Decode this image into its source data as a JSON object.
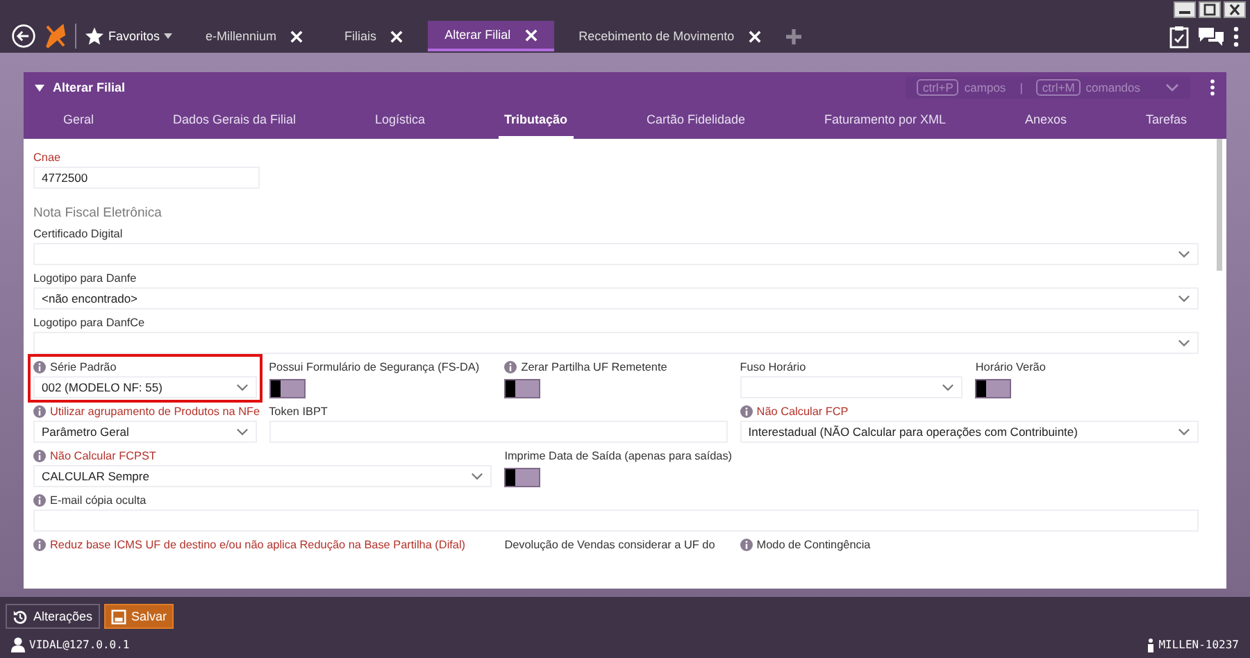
{
  "top_bar": {
    "favorites": "Favoritos",
    "tabs": [
      {
        "label": "e-Millennium",
        "selected": false
      },
      {
        "label": "Filiais",
        "selected": false
      },
      {
        "label": "Alterar Filial",
        "selected": true
      },
      {
        "label": "Recebimento de Movimento",
        "selected": false
      }
    ]
  },
  "panel": {
    "title": "Alterar Filial",
    "shortcuts": [
      {
        "key": "ctrl+P",
        "label": "campos"
      },
      {
        "key": "ctrl+M",
        "label": "comandos"
      }
    ],
    "separator": "|",
    "tabs": [
      {
        "label": "Geral",
        "selected": false
      },
      {
        "label": "Dados Gerais da Filial",
        "selected": false
      },
      {
        "label": "Logística",
        "selected": false
      },
      {
        "label": "Tributação",
        "selected": true
      },
      {
        "label": "Cartão Fidelidade",
        "selected": false
      },
      {
        "label": "Faturamento por XML",
        "selected": false
      },
      {
        "label": "Anexos",
        "selected": false
      },
      {
        "label": "Tarefas",
        "selected": false
      }
    ]
  },
  "form": {
    "fields": [
      {
        "kind": "text",
        "label": "Cnae",
        "required": true,
        "info": false,
        "value": "4772500"
      },
      {
        "kind": "section",
        "label": "Nota Fiscal Eletrônica"
      },
      {
        "kind": "select",
        "label": "Certificado Digital",
        "required": false,
        "info": false
      },
      {
        "kind": "select",
        "label": "Logotipo para Danfe",
        "required": false,
        "info": false,
        "value": "<não encontrado>"
      },
      {
        "kind": "select",
        "label": "Logotipo para DanfCe",
        "required": false,
        "info": false
      },
      {
        "kind": "select",
        "label": "Série Padrão",
        "required": false,
        "info": true,
        "value": "002 (MODELO NF: 55)",
        "highlighted": true
      },
      {
        "kind": "toggle",
        "label": "Possui Formulário de Segurança (FS-DA)",
        "required": false,
        "info": false,
        "on": false
      },
      {
        "kind": "toggle",
        "label": "Zerar Partilha UF Remetente",
        "required": false,
        "info": true,
        "on": false
      },
      {
        "kind": "select",
        "label": "Fuso Horário",
        "required": false,
        "info": false
      },
      {
        "kind": "toggle",
        "label": "Horário Verão",
        "required": false,
        "info": false,
        "on": false
      },
      {
        "kind": "select",
        "label": "Utilizar agrupamento de Produtos na NFe",
        "required": true,
        "info": true,
        "value": "Parâmetro Geral"
      },
      {
        "kind": "text",
        "label": "Token IBPT",
        "required": false,
        "info": false
      },
      {
        "kind": "select",
        "label": "Não Calcular FCP",
        "required": true,
        "info": true,
        "value": "Interestadual (NÃO Calcular para operações com Contribuinte)"
      },
      {
        "kind": "select",
        "label": "Não Calcular FCPST",
        "required": true,
        "info": true,
        "value": "CALCULAR Sempre"
      },
      {
        "kind": "toggle",
        "label": "Imprime Data de Saída (apenas para saídas)",
        "required": false,
        "info": false,
        "on": false
      },
      {
        "kind": "text",
        "label": "E-mail cópia oculta",
        "required": false,
        "info": true
      },
      {
        "kind": "label",
        "label": "Reduz base ICMS UF de destino e/ou não aplica Redução na Base Partilha (Difal)",
        "required": true,
        "info": true
      },
      {
        "kind": "label",
        "label": "Devolução de Vendas considerar a UF do",
        "required": false,
        "info": false
      },
      {
        "kind": "label",
        "label": "Modo de Contingência",
        "required": false,
        "info": true
      }
    ]
  },
  "actions": [
    {
      "label": "Alterações",
      "kind": "history"
    },
    {
      "label": "Salvar",
      "kind": "save"
    }
  ],
  "status_bar": {
    "user": "VIDAL@127.0.0.1",
    "build": "MILLEN-10237"
  }
}
